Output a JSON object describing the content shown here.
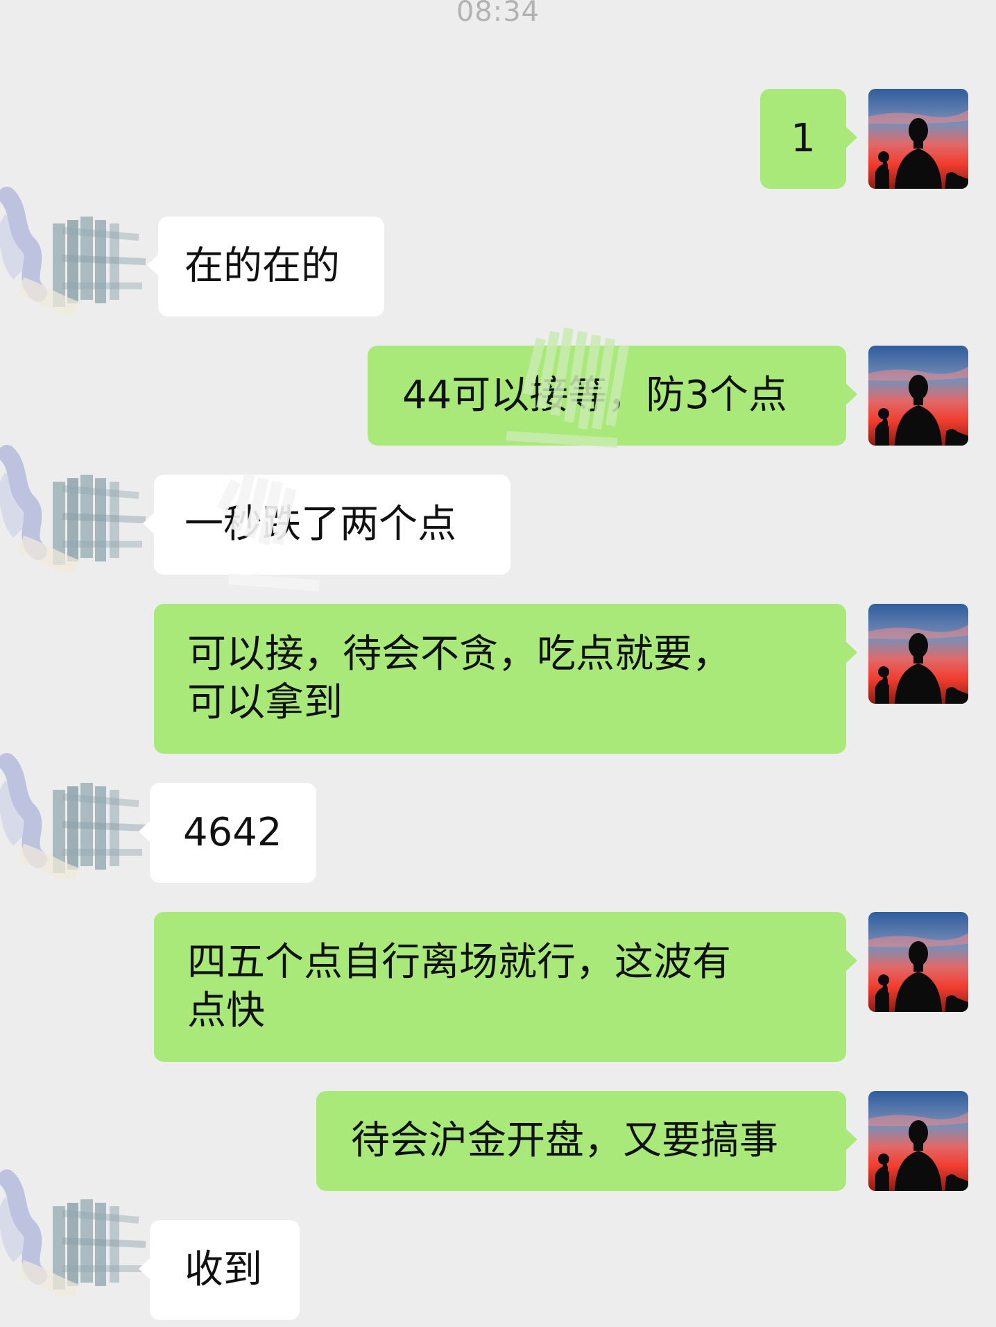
{
  "status": {
    "time": "08:34"
  },
  "messages": [
    {
      "side": "self",
      "text": "1"
    },
    {
      "side": "other",
      "text": "在的在的"
    },
    {
      "side": "self",
      "text": "44可以接等，防3个点"
    },
    {
      "side": "other",
      "text": "一秒跌了两个点"
    },
    {
      "side": "self",
      "text": "可以接，待会不贪，吃点就要，\n可以拿到"
    },
    {
      "side": "other",
      "text": "4642"
    },
    {
      "side": "self",
      "text": "四五个点自行离场就行，这波有\n点快"
    },
    {
      "side": "self",
      "text": "待会沪金开盘，又要搞事"
    },
    {
      "side": "other",
      "text": "收到"
    }
  ],
  "colors": {
    "background": "#ededed",
    "sent_bubble": "#a9e97a",
    "received_bubble": "#ffffff",
    "timestamp": "#b2b2b2"
  },
  "icons": {
    "self_avatar": "silhouette-sunset-avatar-icon",
    "other_avatar": "scribbled-out-avatar"
  }
}
